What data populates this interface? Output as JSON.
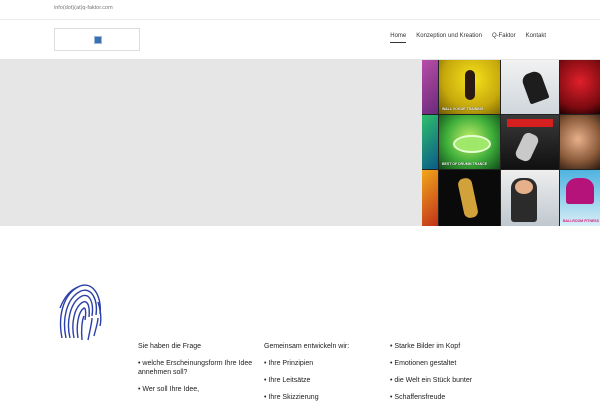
{
  "topbar": {
    "email": "info(dot)(at)q-faktor.com"
  },
  "logo": {
    "icon": "image-icon"
  },
  "nav": {
    "items": [
      {
        "label": "Home",
        "active": true
      },
      {
        "label": "Konzeption und Kreation",
        "active": false
      },
      {
        "label": "Q-Faktor",
        "active": false
      },
      {
        "label": "Kontakt",
        "active": false
      }
    ]
  },
  "hero": {
    "covers": [
      {
        "caption": ""
      },
      {
        "caption": "WALL VOGUE TRAINING"
      },
      {
        "caption": ""
      },
      {
        "caption": ""
      },
      {
        "caption": ""
      },
      {
        "caption": "BEST OF DRUMM TRANCE"
      },
      {
        "caption": ""
      },
      {
        "caption": ""
      },
      {
        "caption": ""
      },
      {
        "caption": ""
      },
      {
        "caption": ""
      },
      {
        "caption": "BALLROOM FITNESS"
      }
    ]
  },
  "decor": {
    "fingerprint_icon": "fingerprint-icon",
    "color": "#2c3fa8"
  },
  "content": {
    "col1": [
      "Sie haben die Frage",
      "• welche Erscheinungsform Ihre Idee annehmen soll?",
      "• Wer soll Ihre Idee,"
    ],
    "col2": [
      "Gemeinsam entwickeln wir:",
      "• Ihre Prinzipien",
      "• Ihre Leitsätze",
      "• Ihre Skizzierung"
    ],
    "col3": [
      "• Starke Bilder im Kopf",
      "• Emotionen gestaltet",
      "• die Welt ein Stück bunter",
      "• Schaffensfreude"
    ]
  }
}
